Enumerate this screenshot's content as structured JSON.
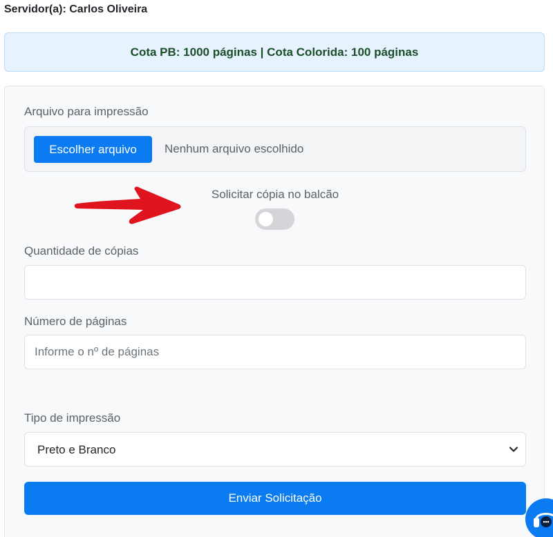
{
  "header": {
    "server_label": "Servidor(a): Carlos Oliveira"
  },
  "quota": {
    "text": "Cota PB: 1000 páginas | Cota Colorida: 100 páginas"
  },
  "form": {
    "file": {
      "label": "Arquivo para impressão",
      "button_label": "Escolher arquivo",
      "status": "Nenhum arquivo escolhido"
    },
    "counter_copy": {
      "label": "Solicitar cópia no balcão",
      "enabled": false
    },
    "copies": {
      "label": "Quantidade de cópias",
      "value": "",
      "placeholder": ""
    },
    "pages": {
      "label": "Número de páginas",
      "value": "",
      "placeholder": "Informe o nº de páginas"
    },
    "print_type": {
      "label": "Tipo de impressão",
      "selected": "Preto e Branco"
    },
    "submit_label": "Enviar Solicitação"
  },
  "icons": {
    "annotation": "red-arrow-icon",
    "support": "headset-icon",
    "select": "chevron-down-icon"
  },
  "colors": {
    "primary": "#0a7bf0",
    "quota_bg": "#e6f2fd",
    "quota_text": "#1b4f2a",
    "arrow": "#e0141e"
  }
}
